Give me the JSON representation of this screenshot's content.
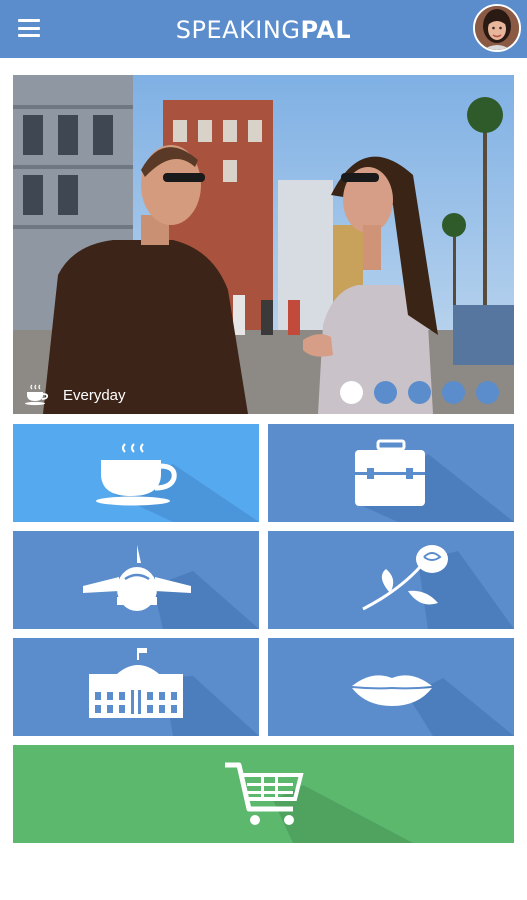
{
  "app": {
    "brand_light": "SPEAKING",
    "brand_bold": "PAL"
  },
  "hero": {
    "category_label": "Everyday",
    "category_icon": "coffee-cup-icon",
    "slide_count": 5,
    "active_slide": 1
  },
  "categories": [
    {
      "id": "everyday",
      "icon": "coffee-cup-icon"
    },
    {
      "id": "business",
      "icon": "briefcase-icon"
    },
    {
      "id": "travel",
      "icon": "airplane-icon"
    },
    {
      "id": "romance",
      "icon": "rose-icon"
    },
    {
      "id": "government",
      "icon": "capitol-building-icon"
    },
    {
      "id": "pronunciation",
      "icon": "lips-icon"
    },
    {
      "id": "shop",
      "icon": "shopping-cart-icon"
    }
  ],
  "colors": {
    "app_bar": "#5b8ccc",
    "tile_blue": "#5b8ccc",
    "tile_light_blue": "#55a9ee",
    "shop_green": "#5cb86c",
    "dot_inactive": "#5b8ccc",
    "dot_active": "#ffffff"
  }
}
